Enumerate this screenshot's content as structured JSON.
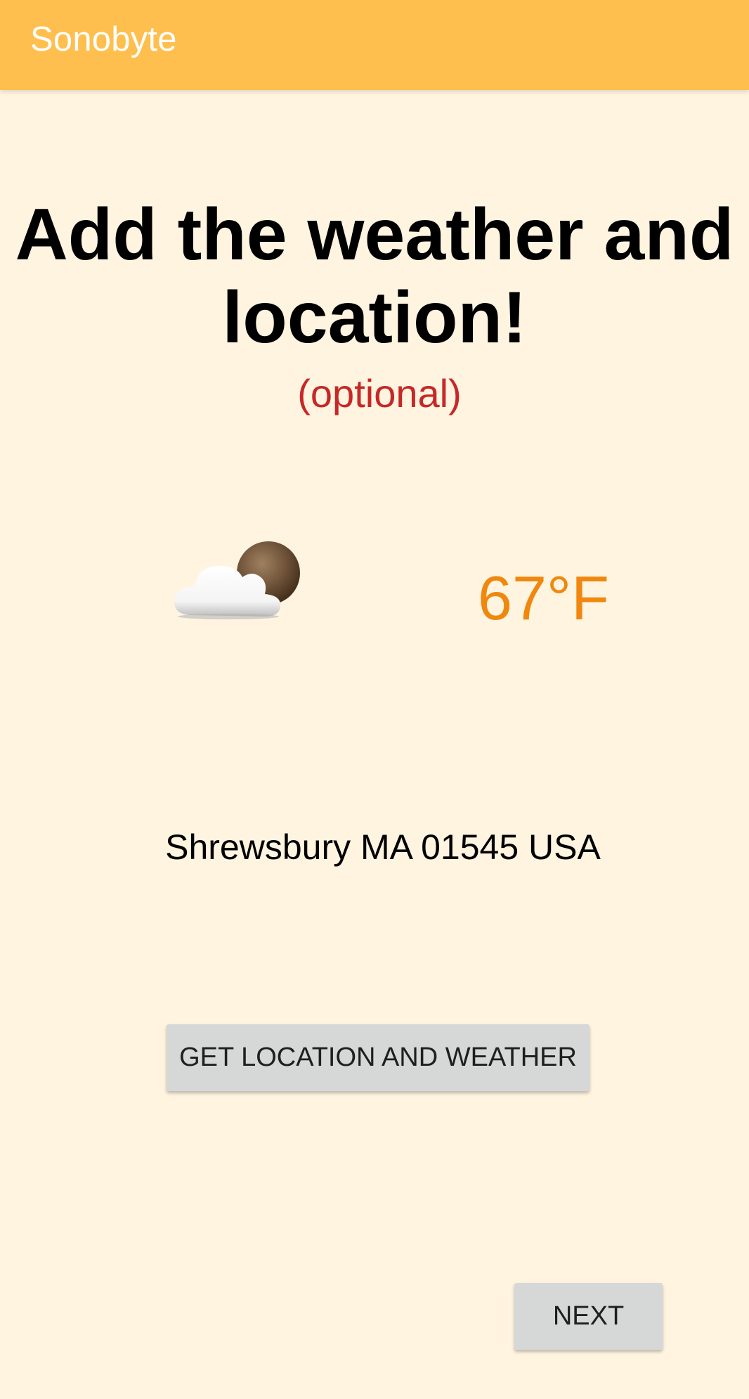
{
  "app_bar": {
    "title": "Sonobyte",
    "color": "#FEBF4E"
  },
  "main": {
    "headline": "Add the weather and location!",
    "optional_note": "(optional)",
    "weather": {
      "icon": "partly-cloudy-night-icon",
      "temperature": "67°F"
    },
    "location": "Shrewsbury MA 01545 USA"
  },
  "actions": {
    "get_location_label": "GET LOCATION AND WEATHER",
    "next_label": "NEXT"
  },
  "colors": {
    "background": "#FFF4E0",
    "accent_orange": "#F0870E",
    "optional_red": "#C62828",
    "button_gray": "#D6D7D7"
  }
}
